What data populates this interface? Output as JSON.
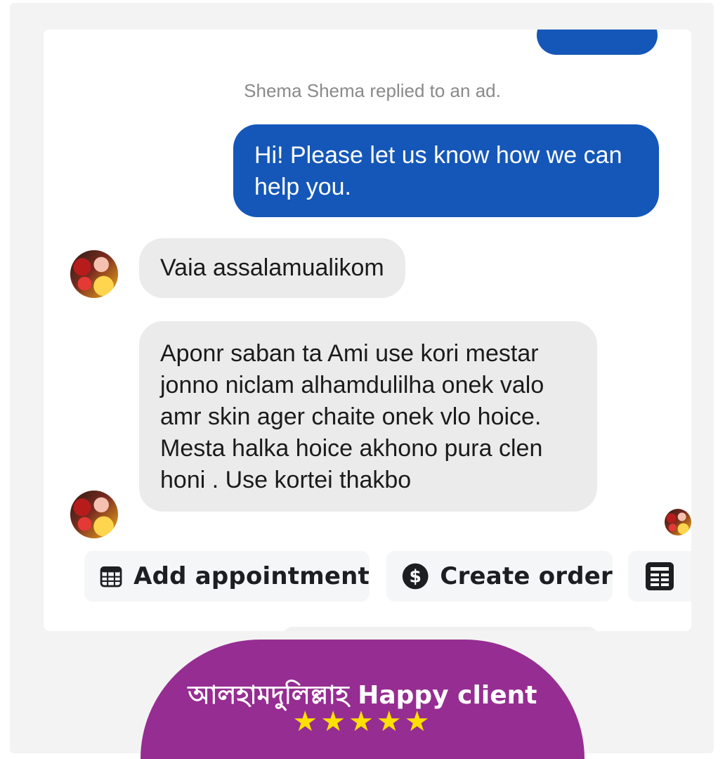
{
  "chat": {
    "notice": "Shema Shema replied to an ad.",
    "outgoing_message": "Hi! Please let us know how we can help you.",
    "incoming_messages": [
      "Vaia assalamualikom",
      "Aponr saban ta Ami use kori mestar jonno niclam alhamdulilha onek valo amr skin ager chaite onek vlo hoice. Mesta halka hoice akhono pura clen honi . Use kortei thakbo"
    ]
  },
  "actions": {
    "add_appointment": {
      "label": "Add appointment",
      "icon": "calendar-icon"
    },
    "create_order": {
      "label": "Create order",
      "icon": "dollar-icon"
    },
    "third_action": {
      "label": "",
      "icon": "document-icon"
    }
  },
  "banner": {
    "title": "আলহামদুলিল্লাহ Happy client",
    "stars": "★★★★★",
    "rating": 5,
    "color": "#962d92",
    "star_color": "#ffe000"
  },
  "colors": {
    "outgoing_bubble": "#1557b8",
    "incoming_bubble": "#ebebeb"
  }
}
